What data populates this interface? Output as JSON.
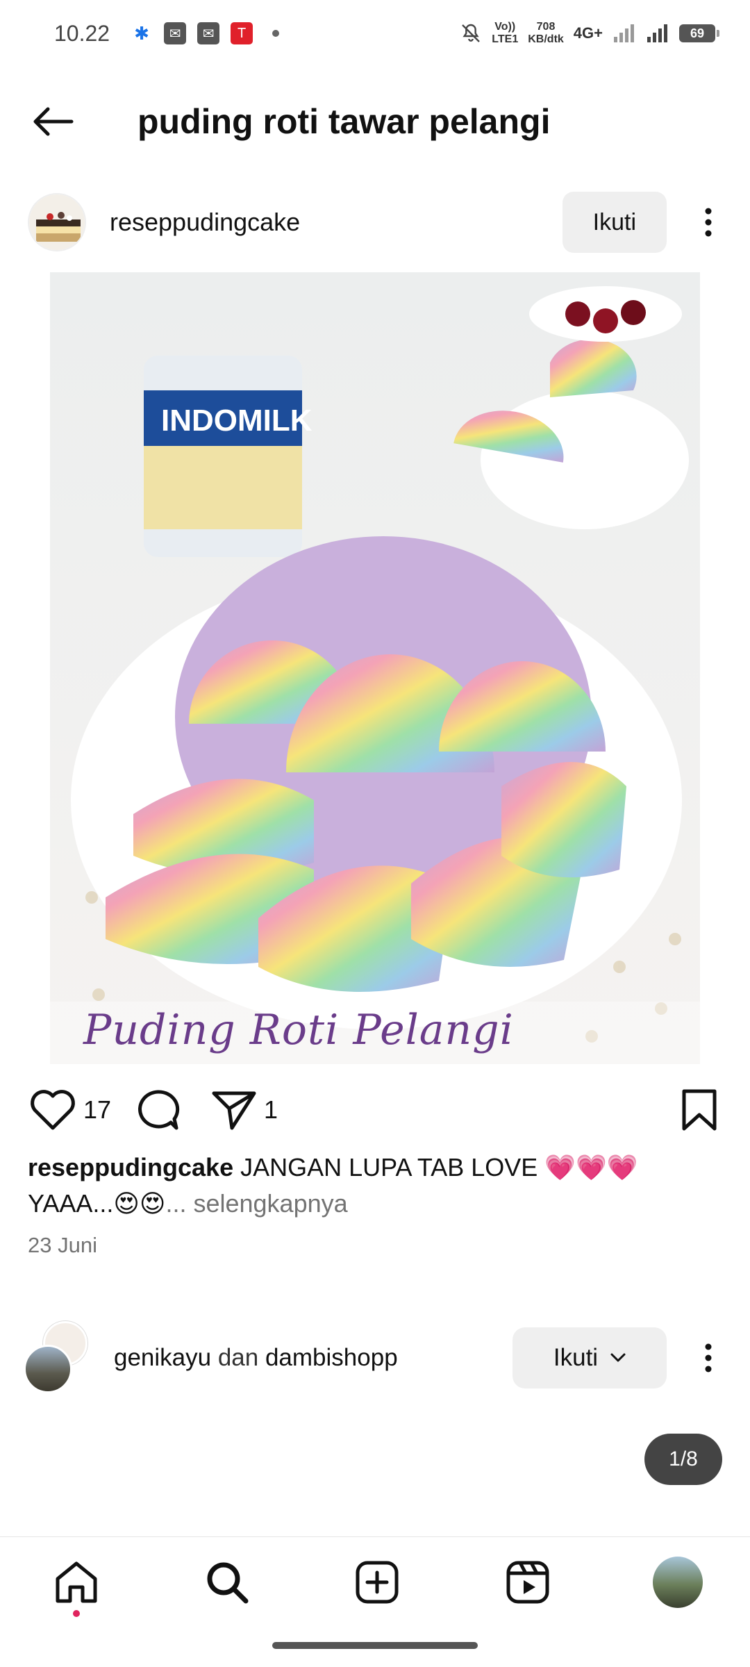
{
  "status_bar": {
    "time": "10.22",
    "network_top": "Vo))",
    "network_bottom": "LTE1",
    "speed_top": "708",
    "speed_bottom": "KB/dtk",
    "network_type": "4G+",
    "battery": "69"
  },
  "header": {
    "title": "puding roti tawar pelangi"
  },
  "post": {
    "username": "reseppudingcake",
    "follow_label": "Ikuti",
    "image_caption": "Puding Roti Pelangi",
    "likes": "17",
    "shares": "1",
    "caption_user": "reseppudingcake",
    "caption_text": " JANGAN LUPA TAB LOVE 💗💗💗 YAAA...😍😍",
    "caption_more": "... selengkapnya",
    "date": "23 Juni"
  },
  "suggestion": {
    "user1": "genikayu",
    "joiner": " dan ",
    "user2": "dambishopp",
    "follow_label": "Ikuti"
  },
  "pager": "1/8",
  "colors": {
    "follow_bg": "#efefef",
    "accent_dot": "#e0245e",
    "caption_purple": "#6a3c8a"
  }
}
